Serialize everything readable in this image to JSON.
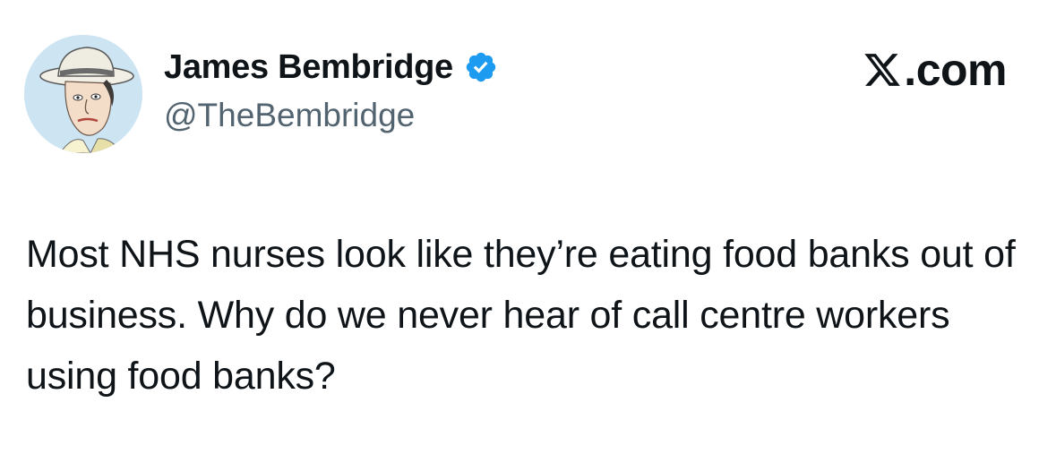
{
  "tweet": {
    "author": {
      "display_name": "James Bembridge",
      "handle": "@TheBembridge",
      "verified": true,
      "verified_icon": "verified-badge-icon",
      "verified_color": "#1d9bf0",
      "avatar": "caricature-avatar"
    },
    "brand": {
      "icon": "x-logo-icon",
      "text": ".com"
    },
    "text": "Most NHS nurses look like they’re eating food banks out of business. Why do we never hear of call centre workers using food banks?"
  },
  "colors": {
    "text": "#0f1419",
    "secondary": "#536471",
    "accent": "#1d9bf0",
    "background": "#ffffff"
  }
}
